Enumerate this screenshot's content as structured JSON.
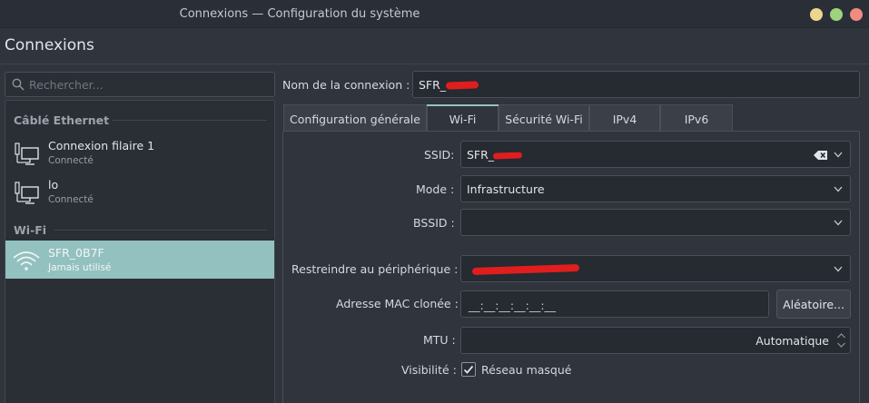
{
  "window": {
    "title": "Connexions — Configuration du système"
  },
  "page": {
    "heading": "Connexions"
  },
  "search": {
    "placeholder": "Rechercher..."
  },
  "sidebar": {
    "groups": [
      {
        "label": "Câblé Ethernet"
      },
      {
        "label": "Wi-Fi"
      }
    ],
    "items": [
      {
        "name": "Connexion filaire 1",
        "status": "Connecté",
        "icon": "wired-network-icon"
      },
      {
        "name": "lo",
        "status": "Connecté",
        "icon": "wired-network-icon"
      },
      {
        "name": "SFR_0B7F",
        "status": "Jamais utilisé",
        "icon": "wifi-icon",
        "selected": true
      }
    ]
  },
  "form": {
    "connection_name_label": "Nom de la connexion :",
    "connection_name_value": "SFR_",
    "tabs": [
      {
        "label": "Configuration générale"
      },
      {
        "label": "Wi-Fi",
        "active": true
      },
      {
        "label": "Sécurité Wi-Fi"
      },
      {
        "label": "IPv4"
      },
      {
        "label": "IPv6"
      }
    ],
    "ssid_label": "SSID:",
    "ssid_value": "SFR_",
    "mode_label": "Mode :",
    "mode_value": "Infrastructure",
    "bssid_label": "BSSID :",
    "bssid_value": "",
    "device_label": "Restreindre au périphérique :",
    "device_value": "",
    "mac_label": "Adresse MAC clonée :",
    "mac_value": "__:__:__:__:__:__",
    "random_button": "Aléatoire...",
    "mtu_label": "MTU :",
    "mtu_value": "Automatique",
    "visibility_label": "Visibilité :",
    "hidden_network_label": "Réseau masqué",
    "hidden_network_checked": true
  },
  "colors": {
    "accent": "#93c1bf",
    "background": "#2f343d",
    "redaction": "#e01e1e"
  }
}
